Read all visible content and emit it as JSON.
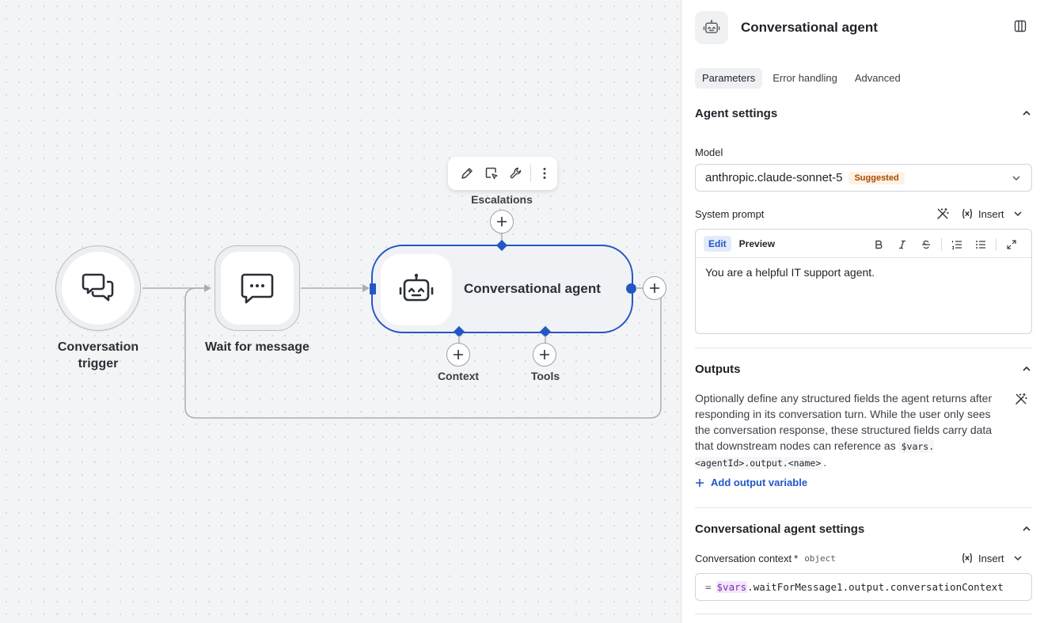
{
  "canvas": {
    "nodes": {
      "trigger": {
        "label_line1": "Conversation",
        "label_line2": "trigger"
      },
      "wait": {
        "label": "Wait for message"
      },
      "agent": {
        "label": "Conversational agent"
      }
    },
    "handles": {
      "escalations": "Escalations",
      "context": "Context",
      "tools": "Tools"
    },
    "toolbar": {
      "icons": [
        "pencil-icon",
        "select-cursor-icon",
        "wrench-icon",
        "more-vertical-icon"
      ]
    },
    "colors": {
      "selection": "#2357c6",
      "edge": "#a9aeb6"
    }
  },
  "panel": {
    "title": "Conversational agent",
    "tabs": [
      "Parameters",
      "Error handling",
      "Advanced"
    ],
    "active_tab": "Parameters",
    "agent_settings": {
      "title": "Agent settings",
      "model_label": "Model",
      "model_value": "anthropic.claude-sonnet-5",
      "model_badge": "Suggested",
      "system_prompt_label": "System prompt",
      "insert_label": "Insert",
      "editor_modes": [
        "Edit",
        "Preview"
      ],
      "system_prompt_value": "You are a helpful IT support agent."
    },
    "outputs": {
      "title": "Outputs",
      "description": "Optionally define any structured fields the agent returns after responding in its conversation turn. While the user only sees the conversation response, these structured fields carry data that downstream nodes can reference as",
      "code_ref": "$vars.<agentId>.output.<name>",
      "description_end": ".",
      "add_label": "Add output variable"
    },
    "conv_settings": {
      "title": "Conversational agent settings",
      "context_label": "Conversation context",
      "required_mark": "*",
      "context_type": "object",
      "insert_label": "Insert",
      "expr_eq": "=",
      "expr_var": "$vars",
      "expr_rest": ".waitForMessage1.output.conversationContext"
    }
  }
}
